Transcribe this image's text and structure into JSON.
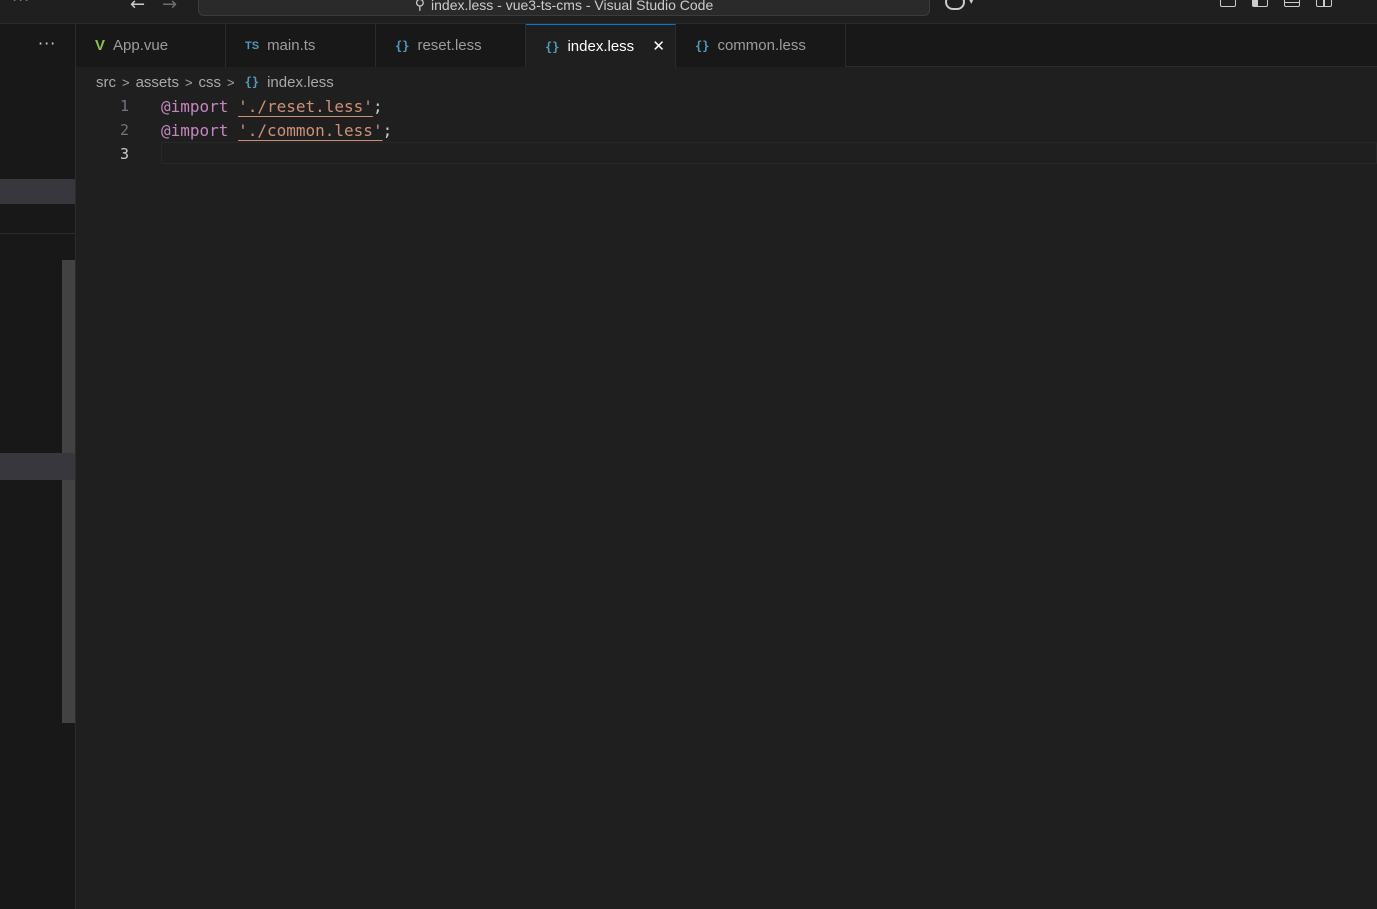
{
  "titlebar": {
    "command_center_text": "index.less - vue3-ts-cms - Visual Studio Code",
    "menu_glyph": "···",
    "back_glyph": "←",
    "forward_glyph": "→"
  },
  "sidebar": {
    "more_glyph": "···"
  },
  "tabs": [
    {
      "label": "App.vue",
      "icon": "vue-icon",
      "icon_text": "V",
      "active": false
    },
    {
      "label": "main.ts",
      "icon": "typescript-icon",
      "icon_text": "TS",
      "active": false
    },
    {
      "label": "reset.less",
      "icon": "less-braces-icon",
      "icon_text": "{}",
      "active": false
    },
    {
      "label": "index.less",
      "icon": "less-braces-icon",
      "icon_text": "{}",
      "active": true
    },
    {
      "label": "common.less",
      "icon": "less-braces-icon",
      "icon_text": "{}",
      "active": false
    }
  ],
  "tab_close_glyph": "✕",
  "breadcrumb": {
    "segments": [
      "src",
      "assets",
      "css"
    ],
    "file": "index.less",
    "file_icon_text": "{}",
    "separator": ">"
  },
  "editor": {
    "lines": [
      {
        "number": "1",
        "keyword": "@import",
        "string": "'./reset.less'",
        "end": ";"
      },
      {
        "number": "2",
        "keyword": "@import",
        "string": "'./common.less'",
        "end": ";"
      },
      {
        "number": "3",
        "keyword": "",
        "string": "",
        "end": ""
      }
    ],
    "current_line": 3
  },
  "colors": {
    "accent": "#0078d4",
    "keyword": "#c586c0",
    "string": "#ce9178",
    "editor_bg": "#1f1f1f"
  }
}
